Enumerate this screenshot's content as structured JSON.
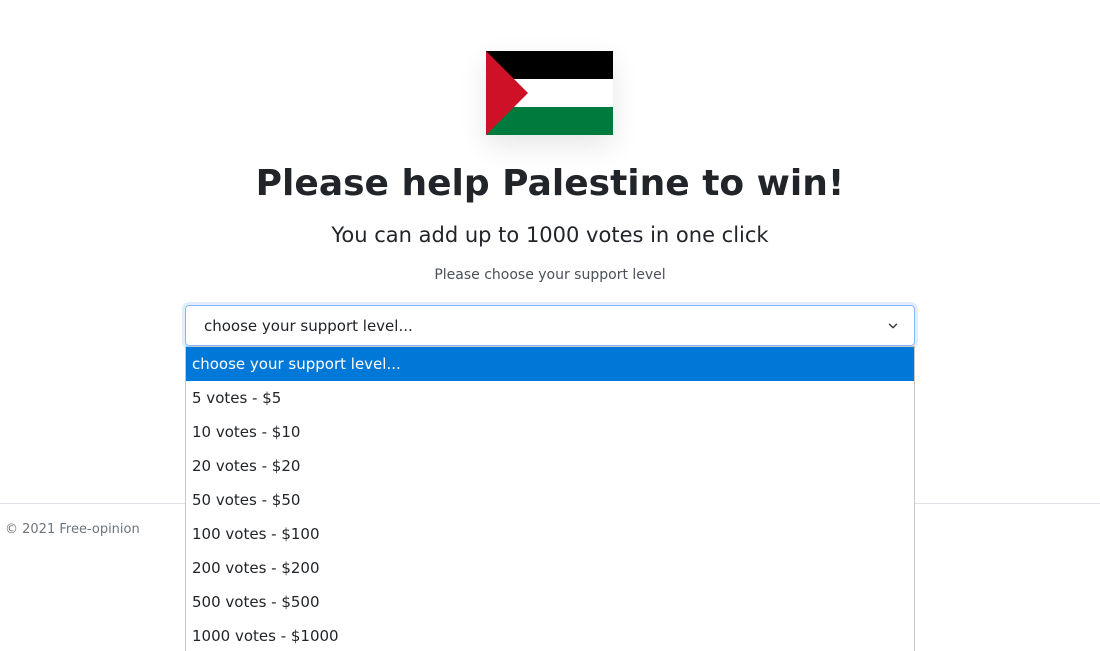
{
  "colors": {
    "flag_black": "#000000",
    "flag_white": "#ffffff",
    "flag_green": "#007a3d",
    "flag_red": "#ce1126",
    "highlight": "#0078d7"
  },
  "header": {
    "flag_icon": "palestine-flag-icon",
    "title": "Please help Palestine to win!",
    "subtitle": "You can add up to 1000 votes in one click",
    "hint": "Please choose your support level"
  },
  "support_select": {
    "selected_value": "choose your support level...",
    "icon": "chevron-down-icon",
    "options": [
      "choose your support level...",
      "5 votes - $5",
      "10 votes - $10",
      "20 votes - $20",
      "50 votes - $50",
      "100 votes - $100",
      "200 votes - $200",
      "500 votes - $500",
      "1000 votes - $1000"
    ],
    "highlighted_index": 0
  },
  "footer": {
    "copyright": "© 2021 Free-opinion"
  }
}
